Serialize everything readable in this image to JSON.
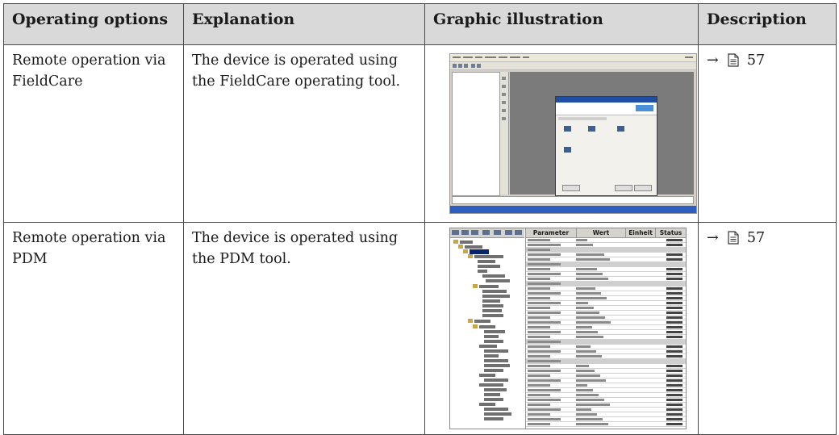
{
  "table": {
    "headers": [
      "Operating options",
      "Explanation",
      "Graphic illustration",
      "Description"
    ],
    "rows": [
      {
        "option": "Remote operation via FieldCare",
        "explanation": "The device is operated using the FieldCare operating tool.",
        "graphic": "FieldCare operating tool screenshot",
        "reference_arrow": "→",
        "page_ref": "57"
      },
      {
        "option": "Remote operation via PDM",
        "explanation": "The device is operated using the PDM tool.",
        "graphic": "PDM tool screenshot",
        "reference_arrow": "→",
        "page_ref": "57"
      }
    ]
  },
  "pdm_grid_headers": [
    "Parameter",
    "Wert",
    "Einheit",
    "Status"
  ],
  "colors": {
    "header_bg": "#d9d9d9",
    "border": "#4a4a4a",
    "fieldcare_workspace": "#7b7b7b",
    "fieldcare_titlebar": "#1f4ea5"
  }
}
